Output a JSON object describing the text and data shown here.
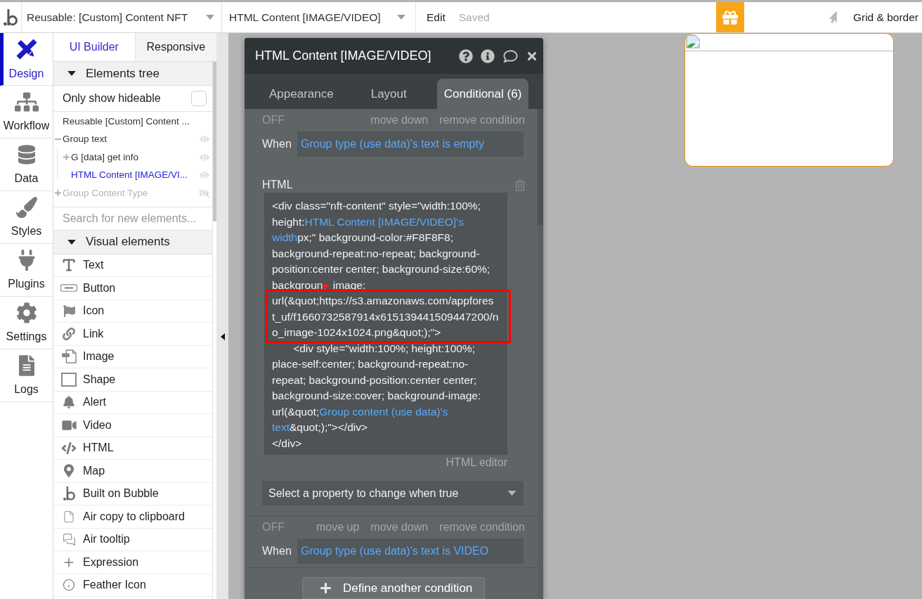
{
  "top_bar": {
    "page_dropdown": {
      "value": "Reusable: [Custom] Content NFT"
    },
    "element_dropdown": {
      "value": "HTML Content [IMAGE/VIDEO]"
    },
    "menu": "Edit",
    "save_status": "Saved",
    "grid_toggle": "Grid & border"
  },
  "nav": [
    {
      "label": "Design",
      "selected": true
    },
    {
      "label": "Workflow",
      "selected": false
    },
    {
      "label": "Data",
      "selected": false
    },
    {
      "label": "Styles",
      "selected": false
    },
    {
      "label": "Plugins",
      "selected": false
    },
    {
      "label": "Settings",
      "selected": false
    },
    {
      "label": "Logs",
      "selected": false
    }
  ],
  "sidebar": {
    "tabs": [
      {
        "label": "UI Builder",
        "selected": true
      },
      {
        "label": "Responsive",
        "selected": false
      }
    ],
    "elements_tree": {
      "title": "Elements tree",
      "expanded": true,
      "filter": {
        "label": "Only show hideable",
        "checked": false
      },
      "items": [
        {
          "label": "Reusable [Custom] Content ...",
          "selected": false,
          "children": [
            {
              "label": "Group text",
              "selected": false,
              "visible": true,
              "expanded": true,
              "children": [
                {
                  "label": "G [data] get info",
                  "selected": false,
                  "visible": true,
                  "expanded": false
                },
                {
                  "label": "HTML Content [IMAGE/VI...",
                  "selected": true,
                  "visible": true
                }
              ]
            },
            {
              "label": "Group Content Type",
              "selected": false,
              "visible": false,
              "expanded": false
            }
          ]
        }
      ]
    },
    "search": {
      "placeholder": "Search for new elements..."
    },
    "visual_elements": {
      "title": "Visual elements",
      "expanded": true,
      "items": [
        {
          "label": "Text"
        },
        {
          "label": "Button"
        },
        {
          "label": "Icon"
        },
        {
          "label": "Link"
        },
        {
          "label": "Image"
        },
        {
          "label": "Shape"
        },
        {
          "label": "Alert"
        },
        {
          "label": "Video"
        },
        {
          "label": "HTML"
        },
        {
          "label": "Map"
        },
        {
          "label": "Built on Bubble"
        },
        {
          "label": "Air copy to clipboard"
        },
        {
          "label": "Air tooltip"
        },
        {
          "label": "Expression"
        },
        {
          "label": "Feather Icon"
        }
      ]
    }
  },
  "panel": {
    "title": "HTML Content [IMAGE/VIDEO]",
    "tabs": [
      {
        "label": "Appearance",
        "selected": false
      },
      {
        "label": "Layout",
        "selected": false
      },
      {
        "label": "Conditional (6)",
        "selected": true
      }
    ],
    "conditions": [
      {
        "status": "OFF",
        "actions": [
          "move down",
          "remove condition"
        ],
        "when_label": "When",
        "expression": "Group type (use data)'s text is empty",
        "properties": [
          {
            "label": "HTML",
            "code_lines": [
              [
                {
                  "kind": "text",
                  "text": "<div class=\"nft-content\" style=\"width:100%;"
                }
              ],
              [
                {
                  "kind": "text",
                  "text": "height:"
                },
                {
                  "kind": "expression",
                  "text": "HTML Content [IMAGE/VIDEO]'s"
                }
              ],
              [
                {
                  "kind": "expression",
                  "text": "width"
                },
                {
                  "kind": "text",
                  "text": "px;\" background-color:#F8F8F8;"
                }
              ],
              [
                {
                  "kind": "text",
                  "text": "background-repeat:no-repeat; background-"
                }
              ],
              [
                {
                  "kind": "text",
                  "text": "position:center center; background-size:60%;"
                }
              ],
              [
                {
                  "kind": "text",
                  "text": "backgroun"
                },
                {
                  "kind": "marker"
                },
                {
                  "kind": "text",
                  "text": " image:"
                }
              ],
              [
                {
                  "kind": "text",
                  "text": "url(&quot;https://s3.amazonaws.com/appfores"
                }
              ],
              [
                {
                  "kind": "text",
                  "text": "t_uf/f1660732587914x615139441509447200/n"
                }
              ],
              [
                {
                  "kind": "text",
                  "text": "o_image-1024x1024.png&quot;);\">"
                }
              ],
              [
                {
                  "kind": "text",
                  "text": "       <div style=\"width:100%; height:100%;"
                }
              ],
              [
                {
                  "kind": "text",
                  "text": "place-self:center; background-repeat:no-"
                }
              ],
              [
                {
                  "kind": "text",
                  "text": "repeat; background-position:center center;"
                }
              ],
              [
                {
                  "kind": "text",
                  "text": "background-size:cover; background-image:"
                }
              ],
              [
                {
                  "kind": "text",
                  "text": "url(&quot;"
                },
                {
                  "kind": "expression",
                  "text": "Group content (use data)'s"
                }
              ],
              [
                {
                  "kind": "expression",
                  "text": "text"
                },
                {
                  "kind": "text",
                  "text": "&quot;);\"></div>"
                }
              ],
              [
                {
                  "kind": "text",
                  "text": "</div>"
                }
              ]
            ],
            "editor_link": "HTML editor"
          }
        ],
        "property_select": {
          "placeholder": "Select a property to change when true"
        }
      },
      {
        "status": "OFF",
        "actions": [
          "move up",
          "move down",
          "remove condition"
        ],
        "when_label": "When",
        "expression": "Group type (use data)'s text is VIDEO"
      }
    ],
    "add_button": "Define another condition"
  },
  "canvas": {
    "element": {
      "selected": true
    }
  }
}
